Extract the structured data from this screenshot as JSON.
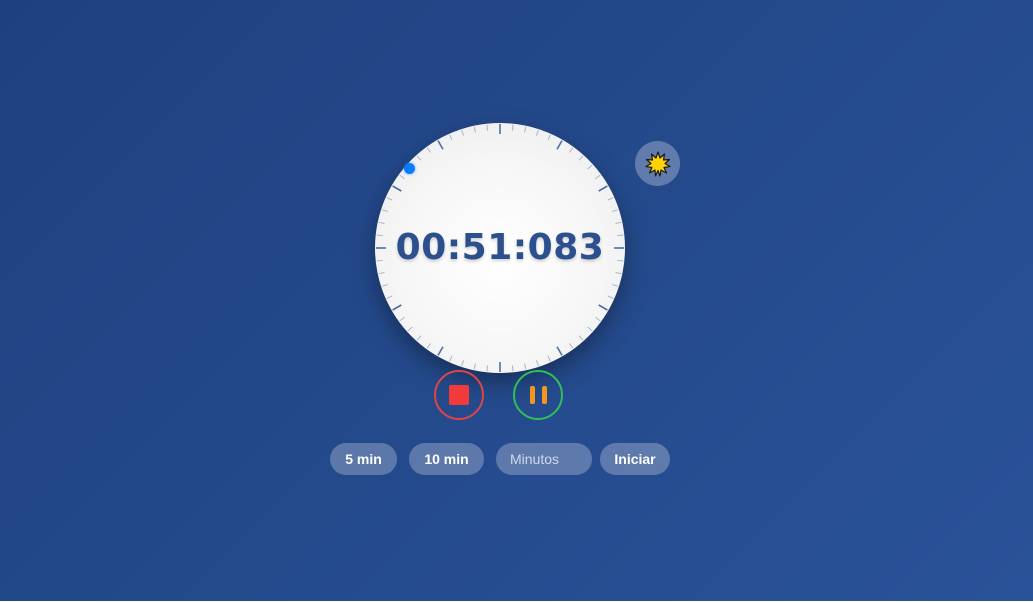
{
  "timer": {
    "display": "00:51:083",
    "progress_fraction": 0.914
  },
  "theme_toggle": {
    "icon": "sun-icon",
    "color": "#ffd400"
  },
  "controls": {
    "stop_icon": "stop-icon",
    "pause_icon": "pause-icon",
    "stop_color": "#f23a3a",
    "pause_color": "#f5961c"
  },
  "presets": {
    "five_label": "5 min",
    "ten_label": "10 min"
  },
  "custom": {
    "placeholder": "Minutos",
    "value": "",
    "start_label": "Iniciar"
  },
  "colors": {
    "accent": "#0a7cff",
    "text": "#2c4f8e"
  }
}
